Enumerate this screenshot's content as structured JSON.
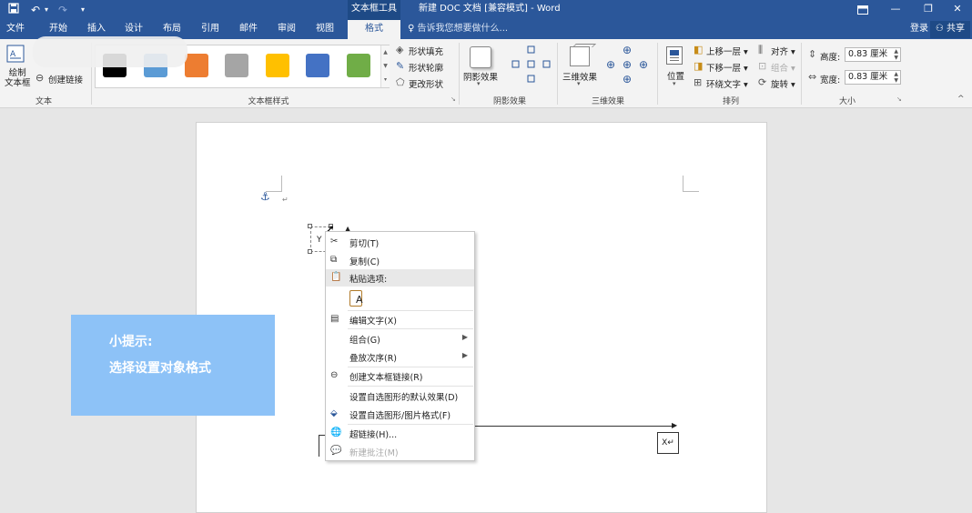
{
  "window": {
    "title": "新建 DOC 文档 [兼容模式] - Word",
    "context_tool": "文本框工具",
    "quick_access": {
      "save": "save-icon",
      "undo": "undo-icon",
      "redo": "redo-icon",
      "more": "▾"
    }
  },
  "tabs": [
    "文件",
    "开始",
    "插入",
    "设计",
    "布局",
    "引用",
    "邮件",
    "审阅",
    "视图",
    "格式"
  ],
  "active_tab": "格式",
  "tell_me": "告诉我您想要做什么...",
  "account": {
    "login": "登录",
    "share": "共享"
  },
  "ribbon": {
    "text_group": {
      "label": "文本",
      "draw_textbox": "绘制\n文本框",
      "create_link": "创建链接"
    },
    "style_group": {
      "label": "文本框样式",
      "swatches": [
        "#000000",
        "#5b9bd5",
        "#ed7d31",
        "#a5a5a5",
        "#ffc000",
        "#4472c4",
        "#70ad47"
      ],
      "shape_fill": "形状填充",
      "shape_outline": "形状轮廓",
      "change_shape": "更改形状"
    },
    "shadow_group": {
      "label": "阴影效果",
      "shadow_effect": "阴影效果"
    },
    "threed_group": {
      "label": "三维效果",
      "threed_effect": "三维效果"
    },
    "arrange_group": {
      "label": "排列",
      "position": "位置",
      "bring_forward": "上移一层",
      "send_backward": "下移一层",
      "wrap_text": "环绕文字",
      "align": "对齐",
      "group": "组合",
      "rotate": "旋转"
    },
    "size_group": {
      "label": "大小",
      "height_label": "高度:",
      "height_value": "0.83 厘米",
      "width_label": "宽度:",
      "width_value": "0.83 厘米"
    }
  },
  "document": {
    "textbox_y": "Y",
    "textbox_x": "X↵",
    "paragraph_mark": "↵"
  },
  "tip": {
    "title": "小提示:",
    "body": "选择设置对象格式"
  },
  "context_menu": {
    "items": [
      {
        "label": "剪切(T)",
        "icon": "scissors-icon"
      },
      {
        "label": "复制(C)",
        "icon": "copy-icon"
      },
      {
        "label": "粘贴选项:",
        "icon": "paste-icon"
      },
      {
        "label": "A",
        "icon": "paste-text-only-icon"
      },
      {
        "label": "编辑文字(X)",
        "icon": "edit-text-icon"
      },
      {
        "label": "组合(G)",
        "icon": ""
      },
      {
        "label": "叠放次序(R)",
        "icon": ""
      },
      {
        "label": "创建文本框链接(R)",
        "icon": "link-icon"
      },
      {
        "label": "设置自选图形的默认效果(D)",
        "icon": ""
      },
      {
        "label": "设置自选图形/图片格式(F)",
        "icon": "format-shape-icon"
      },
      {
        "label": "超链接(H)...",
        "icon": "hyperlink-icon"
      },
      {
        "label": "新建批注(M)",
        "icon": "comment-icon"
      }
    ]
  }
}
